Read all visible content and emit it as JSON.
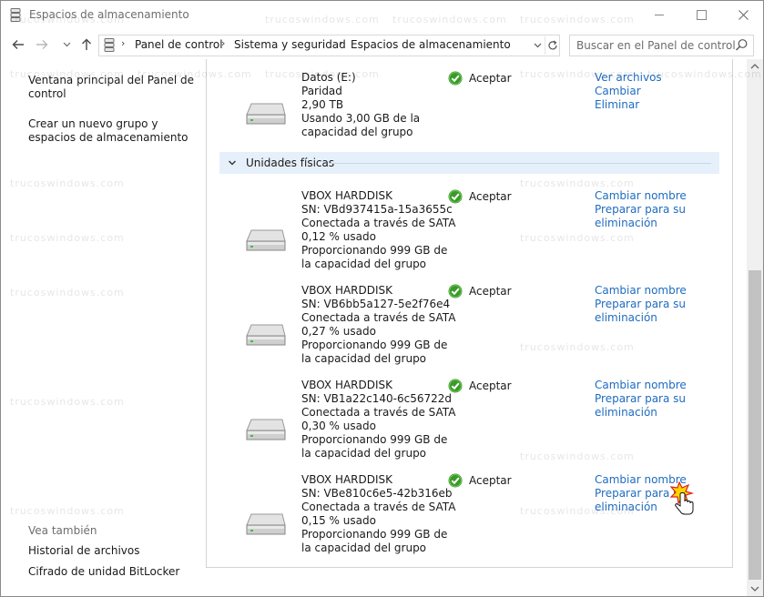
{
  "window": {
    "title": "Espacios de almacenamiento"
  },
  "address": {
    "breadcrumbs": [
      "Panel de control",
      "Sistema y seguridad",
      "Espacios de almacenamiento"
    ]
  },
  "search": {
    "placeholder": "Buscar en el Panel de control"
  },
  "sidebar": {
    "links": [
      {
        "line1": "Ventana principal del Panel de",
        "line2": "control"
      },
      {
        "line1": "Crear un nuevo grupo y",
        "line2": "espacios de almacenamiento"
      }
    ],
    "see_also_label": "Vea también",
    "see_also_links": [
      "Historial de archivos",
      "Cifrado de unidad BitLocker"
    ]
  },
  "space": {
    "lines": [
      "Datos (E:)",
      "Paridad",
      "2,90 TB",
      "Usando 3,00 GB de la",
      "capacidad del grupo"
    ],
    "status": "Aceptar",
    "actions": [
      "Ver archivos",
      "Cambiar",
      "Eliminar"
    ]
  },
  "physical_section": {
    "title": "Unidades físicas"
  },
  "drives": [
    {
      "name": "VBOX HARDDISK",
      "sn": "SN: VBd937415a-15a3655c",
      "connection": "Conectada a través de SATA",
      "usage": "0,12 % usado",
      "capacity1": "Proporcionando 999 GB de",
      "capacity2": "la capacidad del grupo",
      "status": "Aceptar",
      "action1": "Cambiar nombre",
      "action2a": "Preparar para su",
      "action2b": "eliminación"
    },
    {
      "name": "VBOX HARDDISK",
      "sn": "SN: VB6bb5a127-5e2f76e4",
      "connection": "Conectada a través de SATA",
      "usage": "0,27 % usado",
      "capacity1": "Proporcionando 999 GB de",
      "capacity2": "la capacidad del grupo",
      "status": "Aceptar",
      "action1": "Cambiar nombre",
      "action2a": "Preparar para su",
      "action2b": "eliminación"
    },
    {
      "name": "VBOX HARDDISK",
      "sn": "SN: VB1a22c140-6c56722d",
      "connection": "Conectada a través de SATA",
      "usage": "0,30 % usado",
      "capacity1": "Proporcionando 999 GB de",
      "capacity2": "la capacidad del grupo",
      "status": "Aceptar",
      "action1": "Cambiar nombre",
      "action2a": "Preparar para su",
      "action2b": "eliminación"
    },
    {
      "name": "VBOX HARDDISK",
      "sn": "SN: VBe810c6e5-42b316eb",
      "connection": "Conectada a través de SATA",
      "usage": "0,15 % usado",
      "capacity1": "Proporcionando 999 GB de",
      "capacity2": "la capacidad del grupo",
      "status": "Aceptar",
      "action1": "Cambiar nombre",
      "action2a": "Preparar para su",
      "action2b": "eliminación"
    }
  ],
  "watermark_text": "trucoswindows.com",
  "colors": {
    "link": "#1f6cbf",
    "section_bg": "#e6f0fa",
    "status_green": "#3a9a28"
  }
}
